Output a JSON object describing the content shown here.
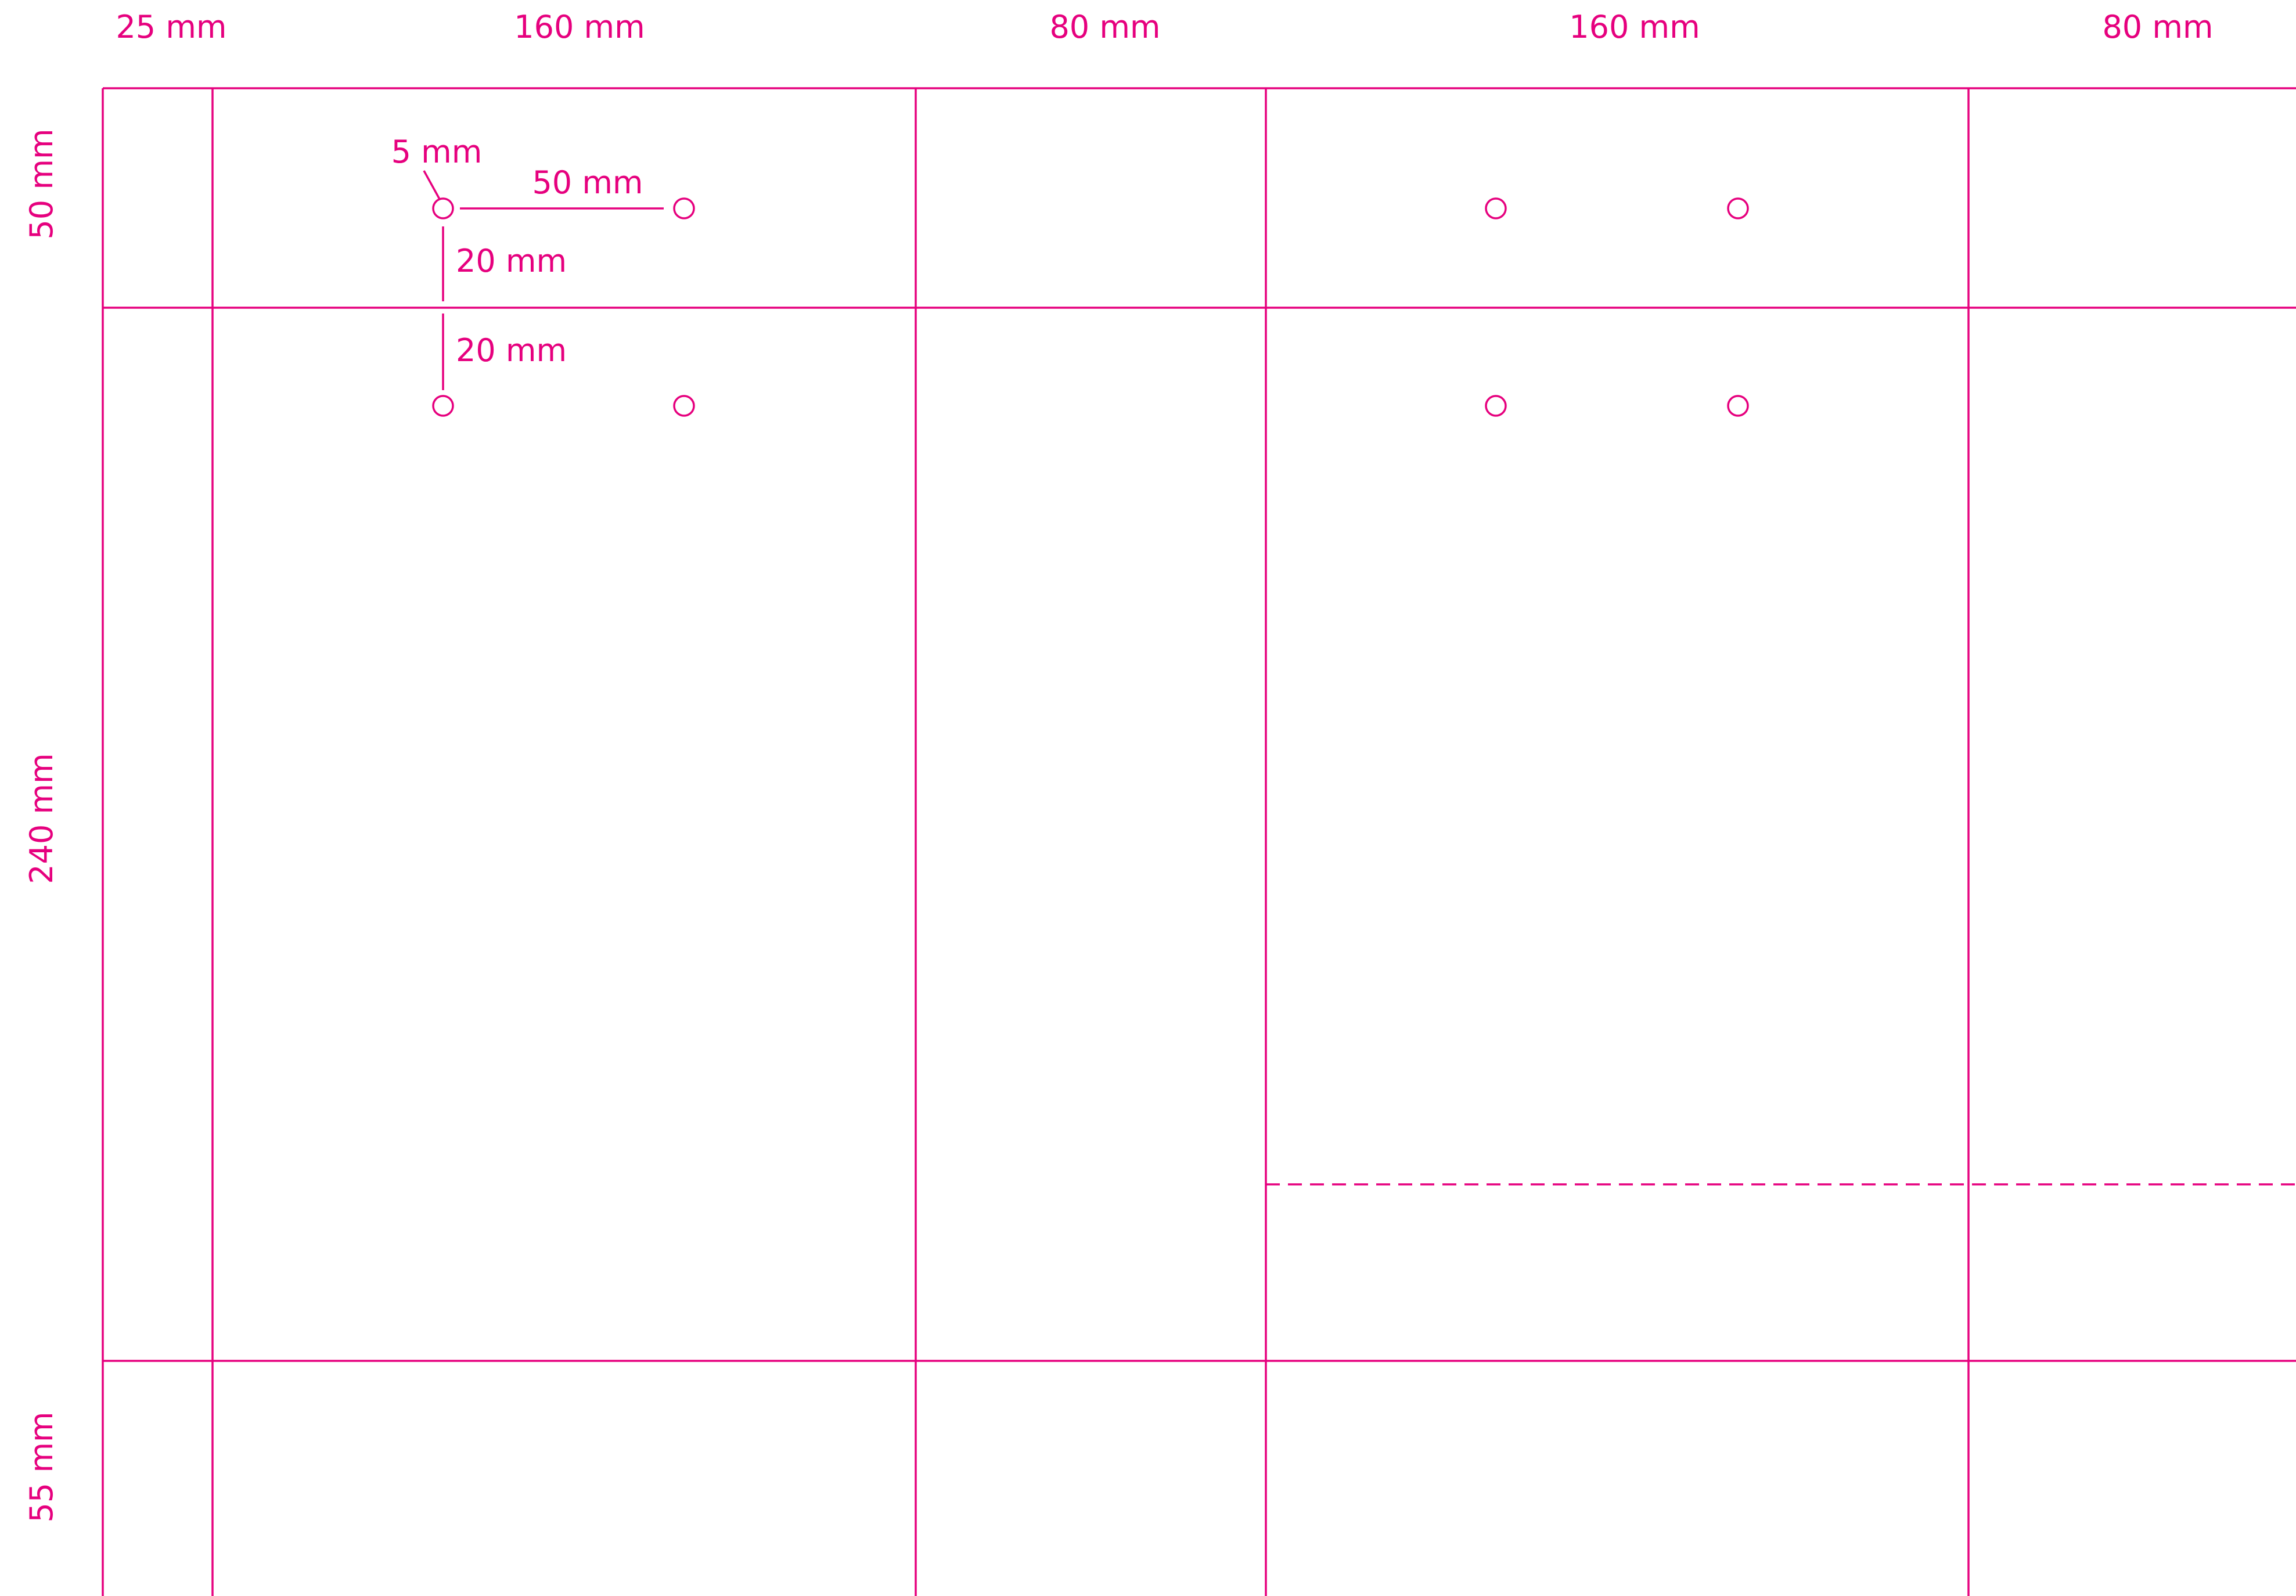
{
  "drawing": {
    "accent_color": "#e6007e",
    "column_labels": [
      "25 mm",
      "160 mm",
      "80 mm",
      "160 mm",
      "80 mm"
    ],
    "row_labels": [
      "50 mm",
      "240 mm",
      "55 mm"
    ],
    "annotations": {
      "hole_diameter": "5 mm",
      "hole_spacing_h": "50 mm",
      "hole_offset_1": "20 mm",
      "hole_offset_2": "20 mm"
    }
  }
}
